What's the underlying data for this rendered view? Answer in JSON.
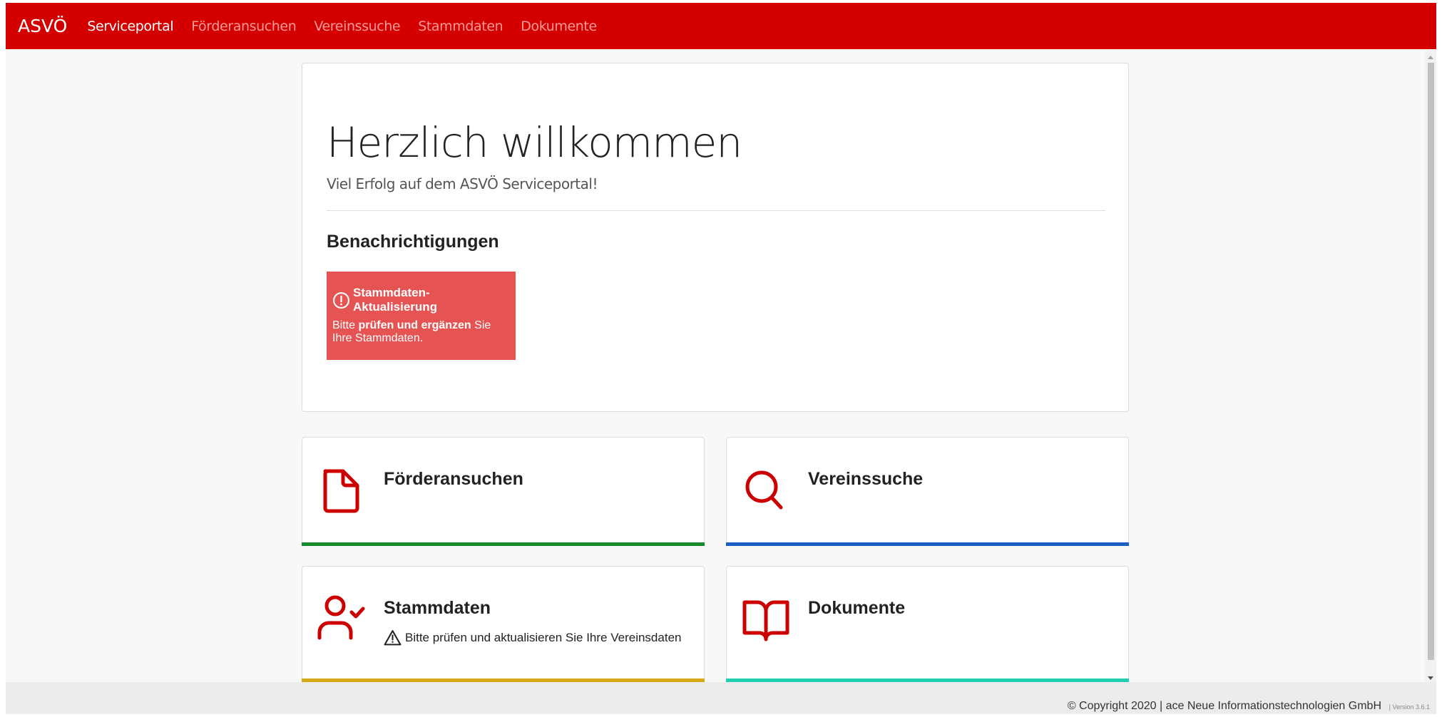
{
  "navbar": {
    "brand": "ASVÖ",
    "items": [
      {
        "label": "Serviceportal",
        "active": true
      },
      {
        "label": "Förderansuchen",
        "active": false
      },
      {
        "label": "Vereinssuche",
        "active": false
      },
      {
        "label": "Stammdaten",
        "active": false
      },
      {
        "label": "Dokumente",
        "active": false
      }
    ]
  },
  "welcome": {
    "title": "Herzlich willkommen",
    "subtitle": "Viel Erfolg auf dem ASVÖ Serviceportal!",
    "notifications_heading": "Benachrichtigungen",
    "alert": {
      "title": "Stammdaten-Aktualisierung",
      "text_before": "Bitte ",
      "text_bold": "prüfen und ergänzen",
      "text_after": " Sie Ihre Stammdaten.",
      "icon": "exclamation-circle-icon"
    }
  },
  "tiles": [
    {
      "title": "Förderansuchen",
      "icon": "file-icon",
      "bar_color": "#168a2a",
      "note": ""
    },
    {
      "title": "Vereinssuche",
      "icon": "search-icon",
      "bar_color": "#1a5fc4",
      "note": ""
    },
    {
      "title": "Stammdaten",
      "icon": "user-check-icon",
      "bar_color": "#d7a915",
      "note": "Bitte prüfen und aktualisieren Sie Ihre Vereinsdaten"
    },
    {
      "title": "Dokumente",
      "icon": "book-open-icon",
      "bar_color": "#1fcfb0",
      "note": ""
    }
  ],
  "footer": {
    "copyright": "© Copyright 2020 | ace Neue Informationstechnologien GmbH",
    "version": "| Version 3.6.1"
  },
  "colors": {
    "brand_red": "#d40000",
    "alert_red": "#e55353",
    "icon_red": "#cc0000"
  }
}
